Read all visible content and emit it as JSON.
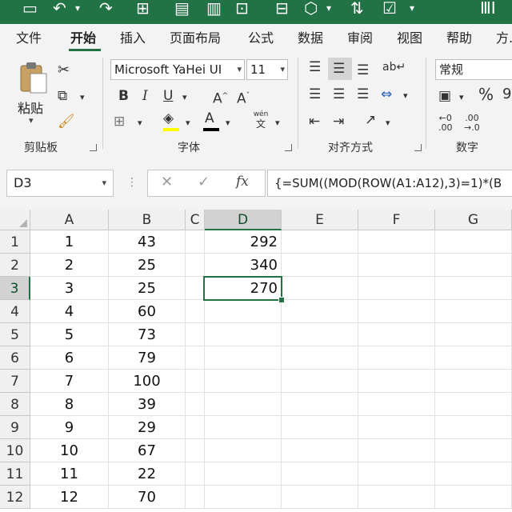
{
  "tabs": [
    "文件",
    "开始",
    "插入",
    "页面布局",
    "公式",
    "数据",
    "审阅",
    "视图",
    "帮助",
    "方..."
  ],
  "active_tab": "开始",
  "ribbon": {
    "paste_label": "粘贴",
    "clipboard_group": "剪贴板",
    "font_group": "字体",
    "alignment_group": "对齐方式",
    "number_group": "数字",
    "font_name": "Microsoft YaHei UI",
    "font_size": "11",
    "number_format": "常规",
    "phonetic_top": "wén",
    "phonetic_bottom": "文",
    "text_color": "#000000",
    "fill_color": "#ffff00"
  },
  "formula_bar": {
    "name_box": "D3",
    "formula": "{=SUM((MOD(ROW(A1:A12),3)=1)*(B"
  },
  "sheet": {
    "columns": [
      "A",
      "B",
      "C",
      "D",
      "E",
      "F",
      "G"
    ],
    "selected_column": "D",
    "selected_row": 3,
    "active_cell": "D3",
    "rows": [
      {
        "n": "1",
        "A": "1",
        "B": "43",
        "D": "292"
      },
      {
        "n": "2",
        "A": "2",
        "B": "25",
        "D": "340"
      },
      {
        "n": "3",
        "A": "3",
        "B": "25",
        "D": "270"
      },
      {
        "n": "4",
        "A": "4",
        "B": "60",
        "D": ""
      },
      {
        "n": "5",
        "A": "5",
        "B": "73",
        "D": ""
      },
      {
        "n": "6",
        "A": "6",
        "B": "79",
        "D": ""
      },
      {
        "n": "7",
        "A": "7",
        "B": "100",
        "D": ""
      },
      {
        "n": "8",
        "A": "8",
        "B": "39",
        "D": ""
      },
      {
        "n": "9",
        "A": "9",
        "B": "29",
        "D": ""
      },
      {
        "n": "10",
        "A": "10",
        "B": "67",
        "D": ""
      },
      {
        "n": "11",
        "A": "11",
        "B": "22",
        "D": ""
      },
      {
        "n": "12",
        "A": "12",
        "B": "70",
        "D": ""
      }
    ]
  },
  "accent_color": "#217346"
}
